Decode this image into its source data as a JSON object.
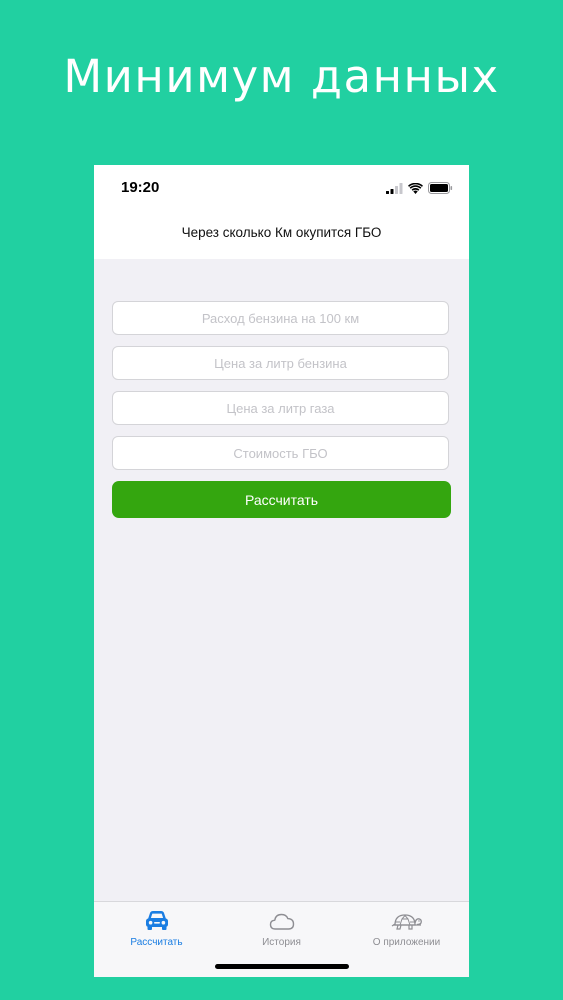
{
  "promo": {
    "headline": "Минимум данных"
  },
  "status_bar": {
    "time": "19:20"
  },
  "nav": {
    "title": "Через сколько Км окупится ГБО"
  },
  "form": {
    "fields": [
      {
        "value": "",
        "placeholder": "Расход бензина на 100 км"
      },
      {
        "value": "",
        "placeholder": "Цена за литр бензина"
      },
      {
        "value": "",
        "placeholder": "Цена за литр газа"
      },
      {
        "value": "",
        "placeholder": "Стоимость ГБО"
      }
    ],
    "submit_label": "Рассчитать"
  },
  "tabbar": {
    "tabs": [
      {
        "label": "Рассчитать",
        "icon": "car-icon",
        "active": true
      },
      {
        "label": "История",
        "icon": "cloud-icon",
        "active": false
      },
      {
        "label": "О приложении",
        "icon": "turtle-icon",
        "active": false
      }
    ]
  },
  "colors": {
    "background": "#21d0a1",
    "button": "#34a60f",
    "active_tab": "#1a7de2",
    "inactive_tab": "#8e8e93"
  }
}
